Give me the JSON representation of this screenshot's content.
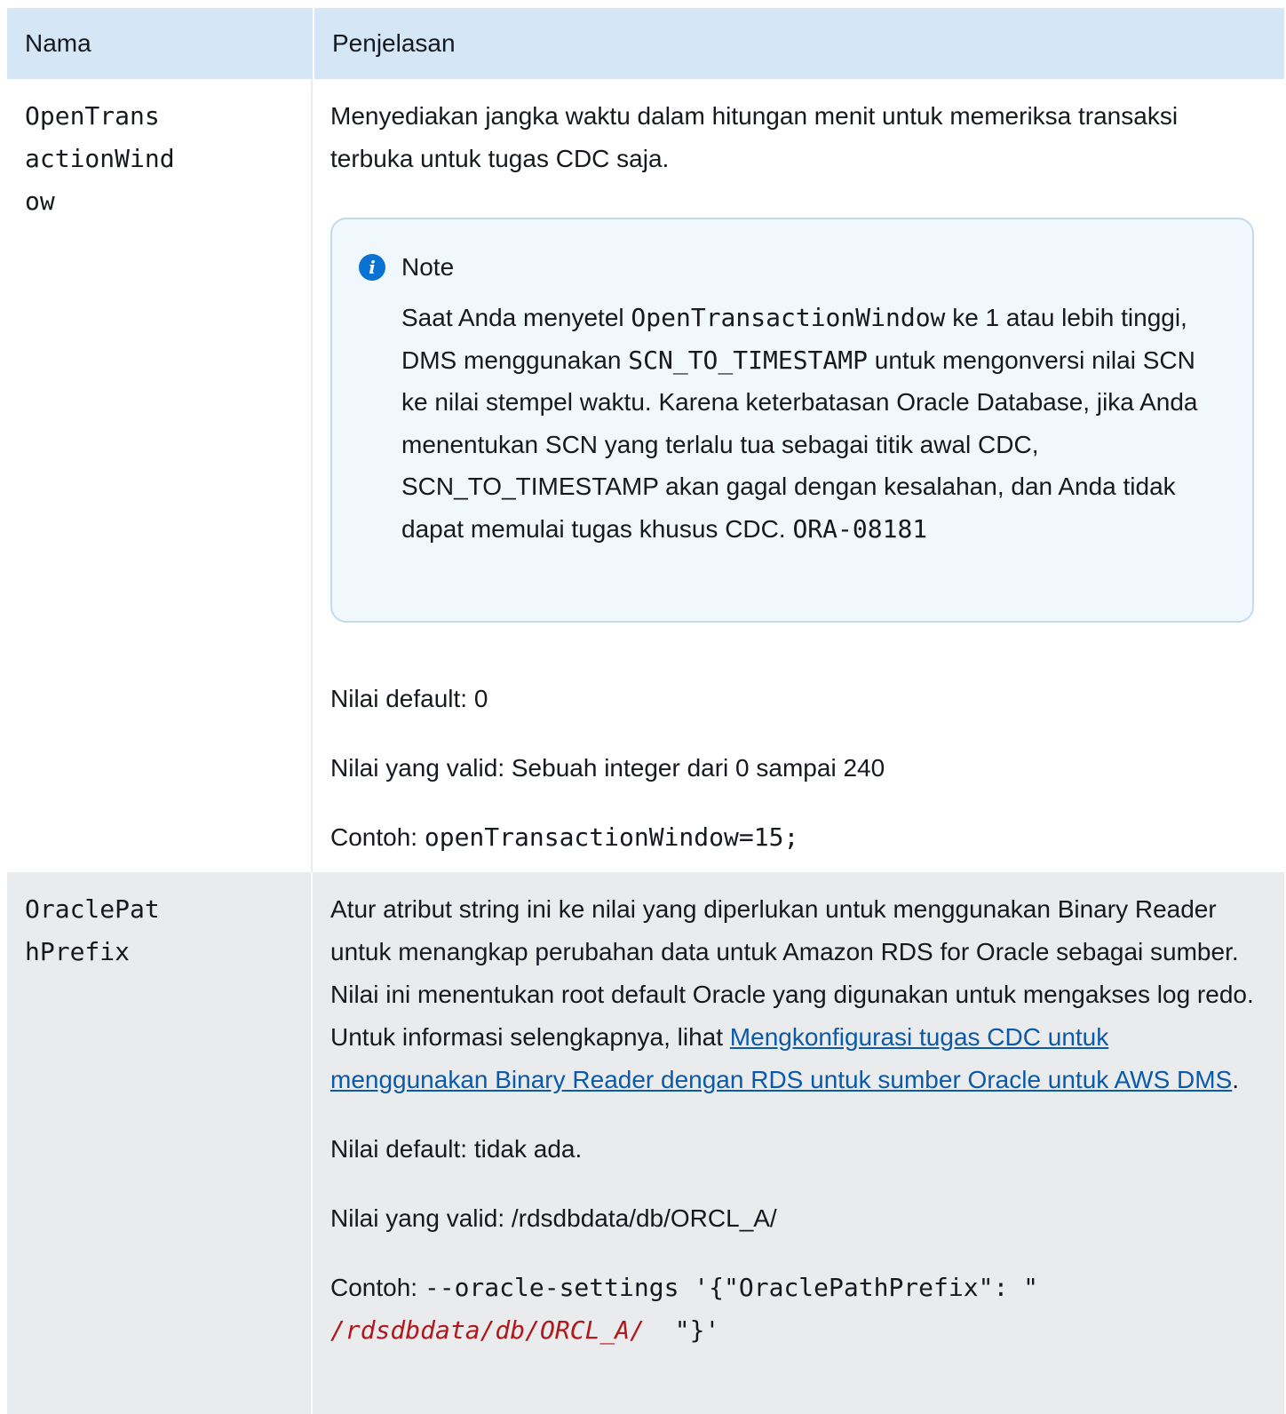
{
  "table": {
    "headers": {
      "name": "Nama",
      "description": "Penjelasan"
    },
    "rows": [
      {
        "name": "OpenTransactionWindow",
        "name_line1": "OpenTrans",
        "name_line2": "actionWindow",
        "description": "Menyediakan jangka waktu dalam hitungan menit untuk memeriksa transaksi terbuka untuk tugas CDC saja.",
        "note": {
          "title": "Note",
          "icon": "info-icon",
          "t1": "Saat Anda menyetel ",
          "code1": "OpenTransactionWindow",
          "t2": " ke 1 atau lebih tinggi, DMS menggunakan ",
          "code2": "SCN_TO_TIMESTAMP",
          "t3": " untuk mengonversi nilai SCN ke nilai stempel waktu. Karena keterbatasan Oracle Database, jika Anda menentukan SCN yang terlalu tua sebagai titik awal CDC, SCN_TO_TIMESTAMP akan gagal dengan kesalahan, dan Anda tidak dapat memulai tugas khusus CDC. ",
          "code3": "ORA-08181"
        },
        "default_value": "Nilai default: 0",
        "valid_values": "Nilai yang valid: Sebuah integer dari 0 sampai 240",
        "example_label": "Contoh: ",
        "example_code": "openTransactionWindow=15;"
      },
      {
        "name": "OraclePathPrefix",
        "name_line1": "OraclePat",
        "name_line2": "hPrefix",
        "description": "Atur atribut string ini ke nilai yang diperlukan untuk menggunakan Binary Reader untuk menangkap perubahan data untuk Amazon RDS for Oracle sebagai sumber. Nilai ini menentukan root default Oracle yang digunakan untuk mengakses log redo. Untuk informasi selengkapnya, lihat ",
        "link_text": " Mengkonfigurasi tugas CDC untuk menggunakan Binary Reader dengan RDS untuk sumber Oracle untuk AWS DMS",
        "after_link": ".",
        "default_value": "Nilai default: tidak ada.",
        "valid_values": "Nilai yang valid: /rdsdbdata/db/ORCL_A/",
        "example_label": "Contoh: ",
        "example_code_a": "--oracle-settings '{\"OraclePathPrefix\": \"   ",
        "example_code_red": "/rdsdbdata/db/ORCL_A/",
        "example_code_b": "  \"}'"
      }
    ]
  }
}
